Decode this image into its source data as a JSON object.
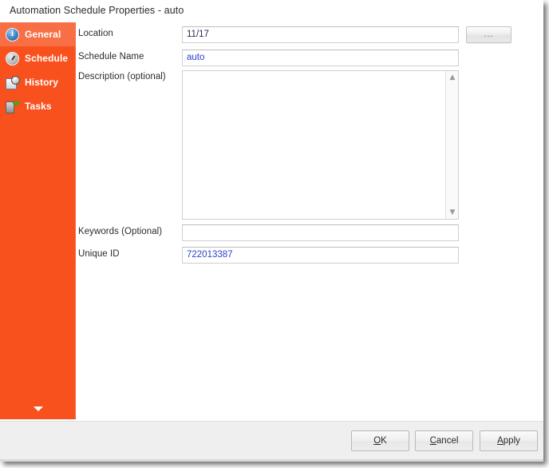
{
  "window": {
    "title": "Automation Schedule Properties - auto",
    "accent_color": "#f9511e",
    "selected_nav_color": "#f96f45"
  },
  "sidebar": {
    "items": [
      {
        "label": "General",
        "icon": "info-icon",
        "selected": true
      },
      {
        "label": "Schedule",
        "icon": "clock-icon",
        "selected": false
      },
      {
        "label": "History",
        "icon": "history-icon",
        "selected": false
      },
      {
        "label": "Tasks",
        "icon": "tasks-icon",
        "selected": false
      }
    ],
    "more_indicator": "chevron-down-icon"
  },
  "form": {
    "fields": [
      {
        "label": "Location",
        "value": "11/17",
        "placeholder": "",
        "type": "text"
      },
      {
        "label": "Schedule Name",
        "value": "auto",
        "placeholder": "",
        "type": "text"
      },
      {
        "label": "Description (optional)",
        "value": "",
        "placeholder": "",
        "type": "textarea"
      },
      {
        "label": "Keywords (Optional)",
        "value": "",
        "placeholder": "",
        "type": "text"
      },
      {
        "label": "Unique ID",
        "value": "722013387",
        "placeholder": "",
        "type": "text"
      }
    ],
    "browse_button_label": "...",
    "scrollbar": {
      "up_arrow": "chevron-up-icon",
      "down_arrow": "chevron-down-icon"
    }
  },
  "footer": {
    "buttons": [
      {
        "label": "OK",
        "accel": "O"
      },
      {
        "label": "Cancel",
        "accel": "C"
      },
      {
        "label": "Apply",
        "accel": "A"
      }
    ]
  }
}
